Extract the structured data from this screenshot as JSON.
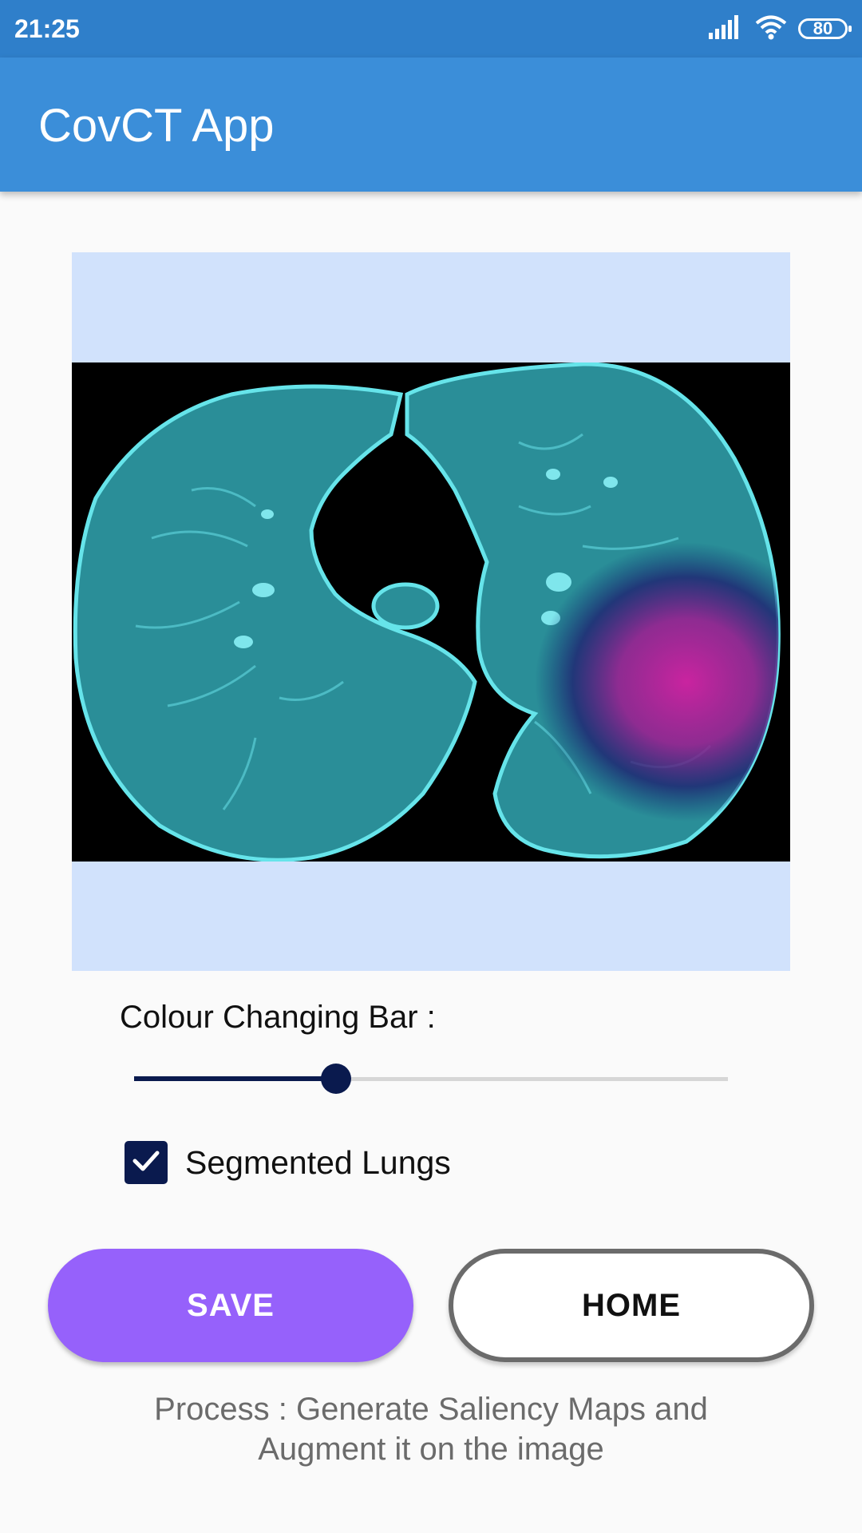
{
  "status_bar": {
    "time": "21:25",
    "battery": "80",
    "icons": [
      "signal-icon",
      "wifi-icon",
      "battery-icon"
    ]
  },
  "app_bar": {
    "title": "CovCT App"
  },
  "image_view": {
    "description_icon": "ct-scan-saliency-image"
  },
  "slider": {
    "label": "Colour Changing Bar :",
    "value_fraction": 0.34
  },
  "checkbox": {
    "label": "Segmented Lungs",
    "checked": true
  },
  "buttons": {
    "save": "SAVE",
    "home": "HOME"
  },
  "process_text": "Process : Generate Saliency Maps and Augment it on the image",
  "colors": {
    "status_bar": "#2f7fca",
    "app_bar": "#3b8ed9",
    "save_button": "#9661fb",
    "slider_accent": "#0a1a4e",
    "image_background": "#d1e2fc"
  }
}
